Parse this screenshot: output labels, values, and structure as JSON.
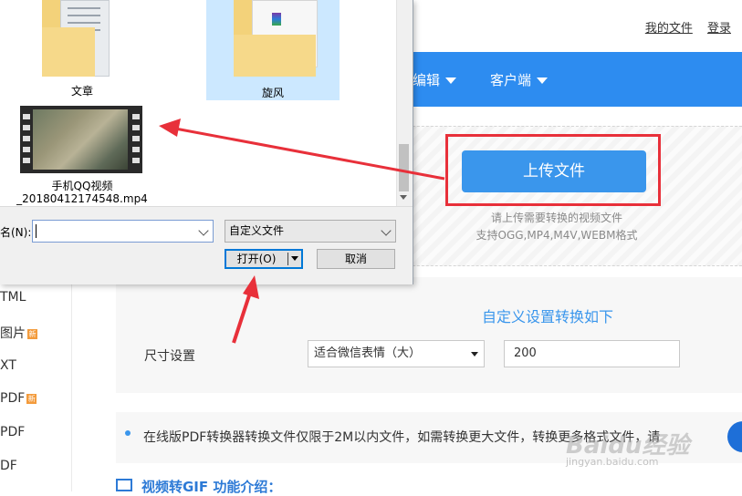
{
  "top_links": {
    "my_files": "我的文件",
    "login": "登录"
  },
  "nav": {
    "item1": "编辑",
    "item2": "客户端"
  },
  "upload": {
    "button_label": "上传文件",
    "hint_line1": "请上传需要转换的视频文件",
    "hint_line2": "支持OGG,MP4,M4V,WEBM格式"
  },
  "settings": {
    "title": "自定义设置转换如下",
    "size_label": "尺寸设置",
    "size_option": "适合微信表情（大）",
    "size_value": "200"
  },
  "notice": {
    "text": "在线版PDF转换器转换文件仅限于2M以内文件，如需转换更大文件，转换更多格式文件，请"
  },
  "intro": {
    "title": "视频转GIF 功能介绍："
  },
  "sidebar": {
    "items": [
      "TML",
      "图片",
      "XT",
      "PDF",
      "PDF",
      "DF"
    ]
  },
  "dialog": {
    "files": [
      {
        "name": "文章"
      },
      {
        "name": "旋风"
      },
      {
        "name_line1": "手机QQ视频",
        "name_line2": "_20180412174548.mp4"
      }
    ],
    "filename_label": "名(N):",
    "filename_value": "",
    "filter_value": "自定义文件",
    "open_button": "打开(O)",
    "cancel_button": "取消"
  },
  "watermark": {
    "brand": "Baidu经验",
    "url": "jingyan.baidu.com"
  },
  "colors": {
    "accent": "#2d8cf0",
    "upload_button": "#3a96ec",
    "highlight_red": "#e8303a",
    "selected_tile": "#cce8ff"
  }
}
